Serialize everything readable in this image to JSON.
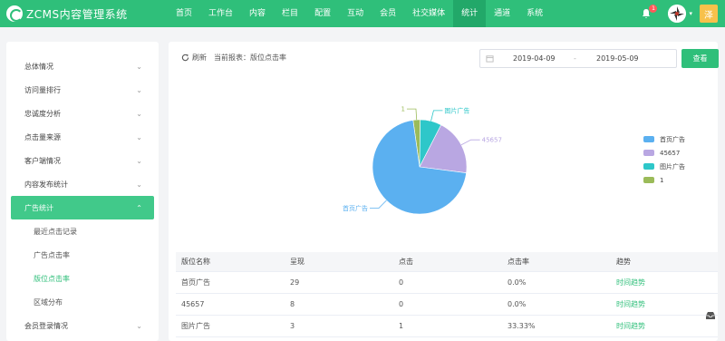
{
  "app": {
    "logo_text": "ZCMS内容管理系统"
  },
  "nav": {
    "items": [
      "首页",
      "工作台",
      "内容",
      "栏目",
      "配置",
      "互动",
      "会员",
      "社交媒体",
      "统计",
      "通道",
      "系统"
    ],
    "active": "统计"
  },
  "header": {
    "notification_count": "1",
    "user_initial": "泽"
  },
  "sidebar": {
    "items": [
      {
        "label": "总体情况"
      },
      {
        "label": "访问量排行"
      },
      {
        "label": "忠诚度分析"
      },
      {
        "label": "点击量来源"
      },
      {
        "label": "客户端情况"
      },
      {
        "label": "内容发布统计"
      },
      {
        "label": "广告统计"
      },
      {
        "label": "会员登录情况"
      }
    ],
    "sub_items": [
      {
        "label": "最近点击记录"
      },
      {
        "label": "广告点击率"
      },
      {
        "label": "版位点击率"
      },
      {
        "label": "区域分布"
      }
    ]
  },
  "toolbar": {
    "refresh_label": "刷新",
    "current_report": "当前报表：版位点击率"
  },
  "daterange": {
    "start": "2019-04-09",
    "separator": "-",
    "end": "2019-05-09"
  },
  "search_button": "查看",
  "colors": {
    "accent": "#2fbf7a",
    "pie1": "#5bb0f0",
    "pie2": "#b9a7e2",
    "pie3": "#2ec7c9",
    "pie4": "#9bbb59"
  },
  "chart_data": {
    "type": "pie",
    "categories": [
      "首页广告",
      "45657",
      "图片广告",
      "1"
    ],
    "values": [
      29,
      8,
      3,
      1
    ],
    "legend_position": "right",
    "slice_labels": [
      "首页广告",
      "45657",
      "图片广告",
      "1"
    ]
  },
  "table": {
    "headers": [
      "版位名称",
      "呈现",
      "点击",
      "点击率",
      "趋势"
    ],
    "rows": [
      [
        "首页广告",
        "29",
        "0",
        "0.0%",
        "时间趋势"
      ],
      [
        "45657",
        "8",
        "0",
        "0.0%",
        "时间趋势"
      ],
      [
        "图片广告",
        "3",
        "1",
        "33.33%",
        "时间趋势"
      ]
    ]
  }
}
